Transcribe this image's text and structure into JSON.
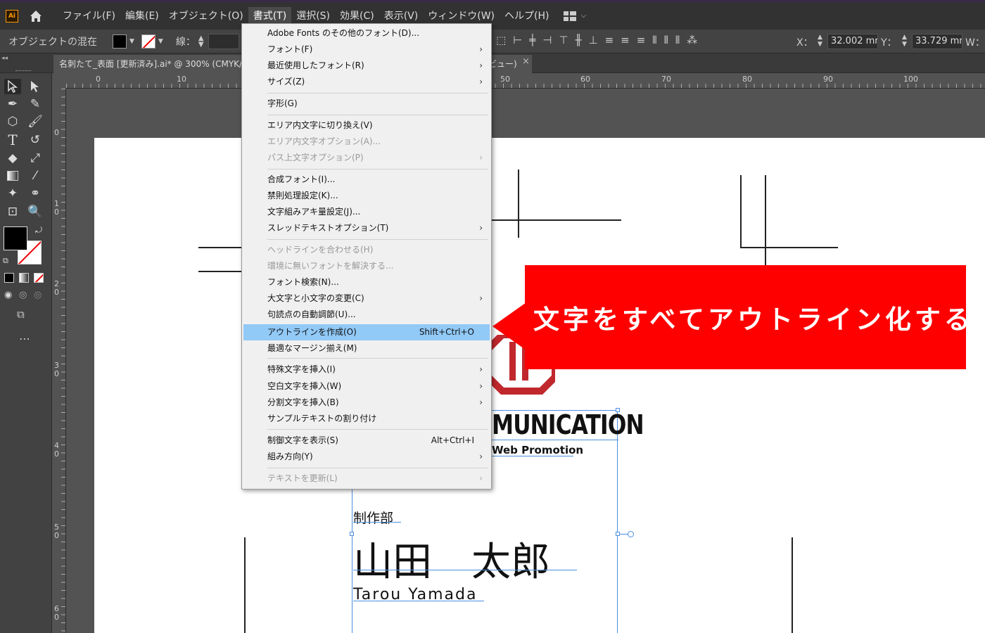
{
  "app": {
    "logo_text": "Ai",
    "menus": [
      "ファイル(F)",
      "編集(E)",
      "オブジェクト(O)",
      "書式(T)",
      "選択(S)",
      "効果(C)",
      "表示(V)",
      "ウィンドウ(W)",
      "ヘルプ(H)"
    ],
    "active_menu_index": 3
  },
  "control_bar": {
    "mixed_label": "オブジェクトの混在",
    "stroke_label": "線：",
    "x_label": "X：",
    "x_value": "32.002 mr",
    "y_label": "Y：",
    "y_value": "33.729 mr",
    "w_label": "W："
  },
  "document": {
    "tab_title": "名刺たて_表面 [更新済み].ai* @ 300% (CMYK/G",
    "tab_suffix": "ビュー)",
    "close_symbol": "×"
  },
  "rulers": {
    "top_ticks": [
      "0",
      "10",
      "50",
      "60",
      "70",
      "80",
      "90",
      "100"
    ],
    "left_ticks": [
      "0",
      "1 0",
      "2 0",
      "3 0",
      "4 0",
      "5 0",
      "6 0"
    ]
  },
  "dropdown": {
    "items": [
      {
        "label": "Adobe Fonts のその他のフォント(D)...",
        "submenu": false,
        "disabled": false
      },
      {
        "label": "フォント(F)",
        "submenu": true,
        "disabled": false
      },
      {
        "label": "最近使用したフォント(R)",
        "submenu": true,
        "disabled": false
      },
      {
        "label": "サイズ(Z)",
        "submenu": true,
        "disabled": false
      },
      {
        "label": "字形(G)",
        "submenu": false,
        "disabled": false
      },
      {
        "label": "エリア内文字に切り換え(V)",
        "submenu": false,
        "disabled": false
      },
      {
        "label": "エリア内文字オプション(A)...",
        "submenu": false,
        "disabled": true
      },
      {
        "label": "パス上文字オプション(P)",
        "submenu": true,
        "disabled": true
      },
      {
        "label": "合成フォント(I)...",
        "submenu": false,
        "disabled": false
      },
      {
        "label": "禁則処理設定(K)...",
        "submenu": false,
        "disabled": false
      },
      {
        "label": "文字組みアキ量設定(J)...",
        "submenu": false,
        "disabled": false
      },
      {
        "label": "スレッドテキストオプション(T)",
        "submenu": true,
        "disabled": false
      },
      {
        "label": "ヘッドラインを合わせる(H)",
        "submenu": false,
        "disabled": true
      },
      {
        "label": "環境に無いフォントを解決する...",
        "submenu": false,
        "disabled": true
      },
      {
        "label": "フォント検索(N)...",
        "submenu": false,
        "disabled": false
      },
      {
        "label": "大文字と小文字の変更(C)",
        "submenu": true,
        "disabled": false
      },
      {
        "label": "句読点の自動調節(U)...",
        "submenu": false,
        "disabled": false
      },
      {
        "label": "アウトラインを作成(O)",
        "submenu": false,
        "disabled": false,
        "shortcut": "Shift+Ctrl+O",
        "highlight": true
      },
      {
        "label": "最適なマージン揃え(M)",
        "submenu": false,
        "disabled": false
      },
      {
        "label": "特殊文字を挿入(I)",
        "submenu": true,
        "disabled": false
      },
      {
        "label": "空白文字を挿入(W)",
        "submenu": true,
        "disabled": false
      },
      {
        "label": "分割文字を挿入(B)",
        "submenu": true,
        "disabled": false
      },
      {
        "label": "サンプルテキストの割り付け",
        "submenu": false,
        "disabled": false
      },
      {
        "label": "制御文字を表示(S)",
        "submenu": false,
        "disabled": false,
        "shortcut": "Alt+Ctrl+I"
      },
      {
        "label": "組み方向(Y)",
        "submenu": true,
        "disabled": false
      },
      {
        "label": "テキストを更新(L)",
        "submenu": true,
        "disabled": true
      }
    ]
  },
  "callout": {
    "text": "文字をすべてアウトライン化する",
    "color": "#ff0000"
  },
  "artboard": {
    "logo_partial": "MUNICATION",
    "tagline_partial": "Web Promotion",
    "department": "制作部",
    "name_jp": "山田　太郎",
    "name_en": "Tarou Yamada"
  },
  "colors": {
    "menu_highlight": "#91c9f7",
    "logo_red": "#c0282d"
  }
}
